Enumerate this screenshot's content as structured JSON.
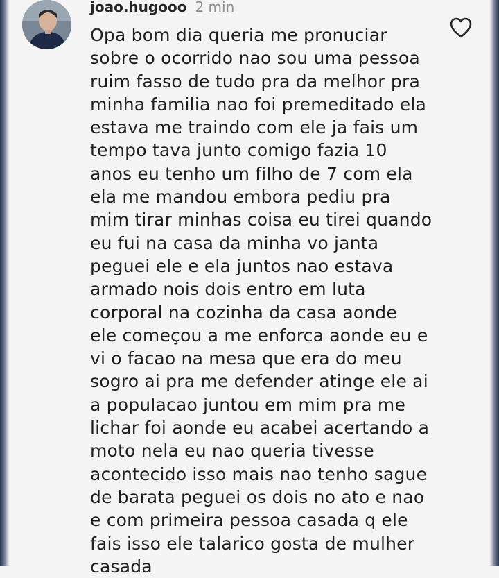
{
  "comment": {
    "username": "joao.hugooo",
    "time": "2 min",
    "text": "Opa bom dia queria me pronuciar\nsobre o ocorrido nao sou uma pessoa\nruim fasso de tudo pra da melhor pra\nminha familia nao foi premeditado ela\nestava me traindo com ele ja fais um\ntempo tava junto comigo fazia 10\nanos eu tenho um filho de 7 com ela\nela me mandou embora pediu pra\nmim tirar minhas coisa eu tirei quando\neu fui na casa da minha vo janta\npeguei ele e ela juntos nao estava\narmado nois dois entro em luta\ncorporal na cozinha da casa  aonde\nele começou a me enforca aonde eu e\nvi o facao na mesa que era do meu\nsogro ai pra me defender atinge ele ai\na populacao juntou em mim pra me\nlichar foi aonde eu acabei acertando a\nmoto nela eu nao queria tivesse\nacontecido isso mais nao tenho sague\nde barata peguei os dois no ato e nao\ne com primeira pessoa casada q ele\nfais isso ele talarico gosta de mulher\ncasada",
    "icons": {
      "avatar": "profile-photo",
      "like": "heart-outline-icon"
    }
  },
  "colors": {
    "background": "#f4f4f4",
    "text": "#1f1f1f",
    "muted": "#8e8e8e",
    "username": "#262626"
  }
}
